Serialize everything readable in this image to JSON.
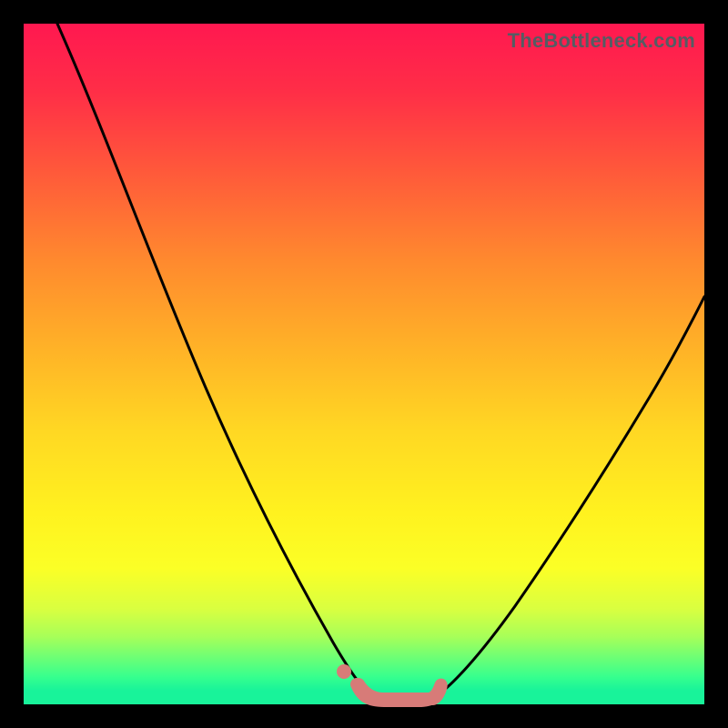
{
  "watermark": "TheBottleneck.com",
  "chart_data": {
    "type": "line",
    "title": "",
    "xlabel": "",
    "ylabel": "",
    "xlim": [
      0,
      100
    ],
    "ylim": [
      0,
      100
    ],
    "grid": false,
    "annotations": [
      {
        "text": "TheBottleneck.com",
        "pos": "top-right"
      }
    ],
    "series": [
      {
        "name": "curve-left",
        "color": "#000000",
        "x": [
          5,
          10,
          15,
          20,
          25,
          30,
          35,
          40,
          44,
          48,
          50
        ],
        "y": [
          100,
          86,
          73,
          60,
          48,
          36,
          25,
          15,
          8,
          3,
          1
        ]
      },
      {
        "name": "curve-right",
        "color": "#000000",
        "x": [
          60,
          64,
          68,
          72,
          76,
          80,
          84,
          88,
          92,
          96,
          100
        ],
        "y": [
          1,
          4,
          8,
          13,
          19,
          26,
          33,
          41,
          49,
          58,
          67
        ]
      },
      {
        "name": "bottom-blob",
        "color": "#d77b78",
        "x": [
          50,
          52,
          54,
          56,
          58,
          60
        ],
        "y": [
          2,
          1,
          1,
          1,
          1,
          2
        ]
      }
    ],
    "markers": [
      {
        "name": "left-dot",
        "x": 47,
        "y": 5,
        "color": "#d77b78",
        "r": 1.5
      }
    ],
    "colors": {
      "border": "#000000",
      "gradient_top": "#ff1850",
      "gradient_mid": "#ffea1f",
      "gradient_bottom": "#18f39a",
      "stroke": "#d77b78"
    }
  }
}
